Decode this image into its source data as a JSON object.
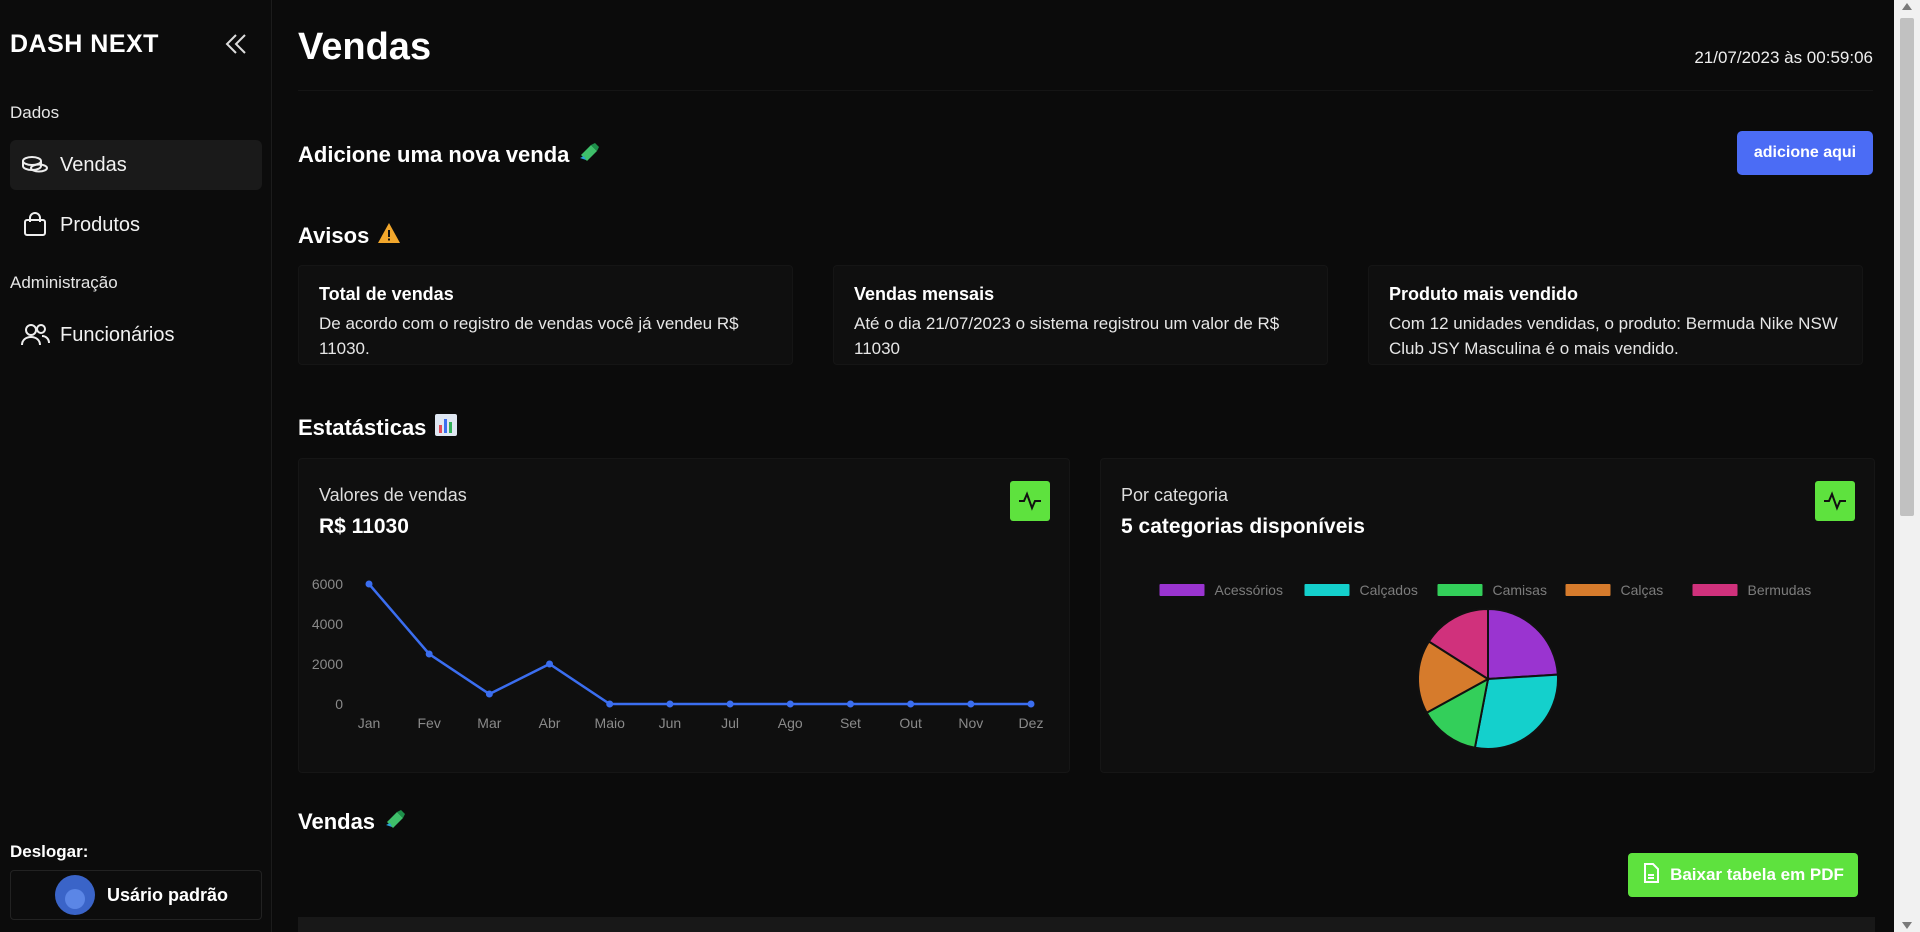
{
  "sidebar": {
    "brand": "DASH NEXT",
    "sections": [
      {
        "label": "Dados"
      },
      {
        "label": "Administração"
      }
    ],
    "items": [
      {
        "label": "Vendas",
        "icon": "coins-icon",
        "active": true
      },
      {
        "label": "Produtos",
        "icon": "shopping-bag-icon",
        "active": false
      },
      {
        "label": "Funcionários",
        "icon": "users-icon",
        "active": false
      }
    ],
    "logout_label": "Deslogar:",
    "user_name": "Usário padrão"
  },
  "header": {
    "title": "Vendas",
    "datetime": "21/07/2023 às 00:59:06"
  },
  "new_sale": {
    "heading": "Adicione uma nova venda",
    "button": "adicione aqui"
  },
  "notices": {
    "heading": "Avisos",
    "cards": [
      {
        "title": "Total de vendas",
        "text_line1": "De acordo com o registro de vendas você já vendeu R$",
        "text_line2": "11030."
      },
      {
        "title": "Vendas mensais",
        "text_line1": "Até o dia 21/07/2023 o sistema registrou um valor de R$",
        "text_line2": "11030"
      },
      {
        "title": "Produto mais vendido",
        "text_line1": "Com 12 unidades vendidas, o produto: Bermuda Nike NSW",
        "text_line2": "Club JSY Masculina é o mais vendido."
      }
    ]
  },
  "stats": {
    "heading": "Estatásticas",
    "sales_panel": {
      "subtitle": "Valores de vendas",
      "value": "R$ 11030"
    },
    "category_panel": {
      "subtitle": "Por categoria",
      "value": "5 categorias disponíveis"
    }
  },
  "sales_table": {
    "heading": "Vendas",
    "pdf_button": "Baixar tabela em PDF"
  },
  "colors": {
    "accent_blue": "#4b6cf5",
    "accent_green": "#5ee23e",
    "line": "#3b6ef0"
  },
  "chart_data": [
    {
      "type": "line",
      "categories": [
        "Jan",
        "Fev",
        "Mar",
        "Abr",
        "Maio",
        "Jun",
        "Jul",
        "Ago",
        "Set",
        "Out",
        "Nov",
        "Dez"
      ],
      "series": [
        {
          "values": [
            6000,
            2500,
            500,
            2000,
            0,
            0,
            0,
            0,
            0,
            0,
            0,
            0
          ],
          "color": "#3b6ef0"
        }
      ],
      "yticks": [
        "0",
        "2000",
        "4000",
        "6000"
      ],
      "ylim": [
        0,
        6000
      ],
      "grid": false
    },
    {
      "type": "pie",
      "labels": [
        "Acessórios",
        "Calçados",
        "Camisas",
        "Calças",
        "Bermudas"
      ],
      "values": [
        24,
        29,
        14,
        17,
        16
      ],
      "colors": [
        "#9a34d0",
        "#14d0cc",
        "#33cf5a",
        "#d67b2c",
        "#d0317c"
      ],
      "legend": "top"
    }
  ]
}
